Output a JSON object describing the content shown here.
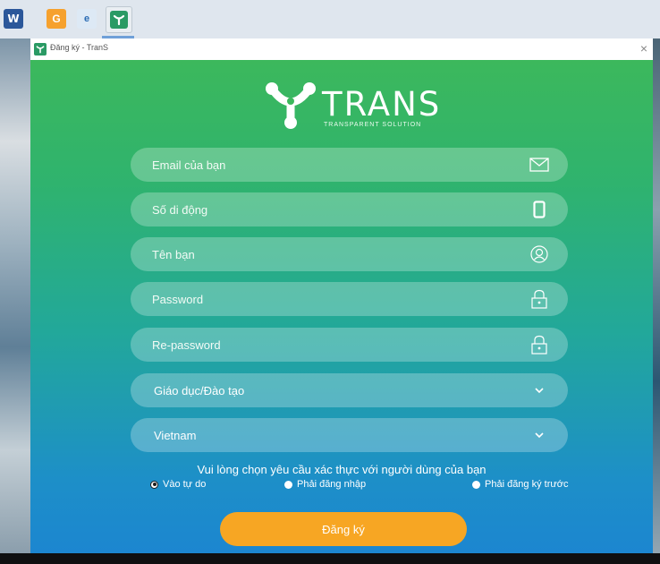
{
  "taskbar": {
    "word_icon_text": "W",
    "orange_icon_text": "G",
    "blue_icon_text": "e"
  },
  "window": {
    "title": "Đăng ký - TranS",
    "close_glyph": "×"
  },
  "logo": {
    "wordmark": "TRANS",
    "tagline": "TRANSPARENT SOLUTION"
  },
  "form": {
    "email_placeholder": "Email của bạn",
    "phone_placeholder": "Số di động",
    "name_placeholder": "Tên bạn",
    "password_placeholder": "Password",
    "repassword_placeholder": "Re-password",
    "industry_value": "Giáo dục/Đào tạo",
    "country_value": "Vietnam"
  },
  "auth": {
    "title": "Vui lòng chọn yêu cầu xác thực với người dùng của bạn",
    "options": [
      "Vào tự do",
      "Phải đăng nhập",
      "Phải đăng ký trước"
    ],
    "selected_index": 0
  },
  "submit_label": "Đăng ký",
  "colors": {
    "gradient_top": "#3cb85c",
    "gradient_bottom": "#1c86d0",
    "button": "#f7a623"
  },
  "icons": [
    "mail-icon",
    "phone-icon",
    "user-icon",
    "lock-icon",
    "chevron-down-icon",
    "close-icon"
  ]
}
